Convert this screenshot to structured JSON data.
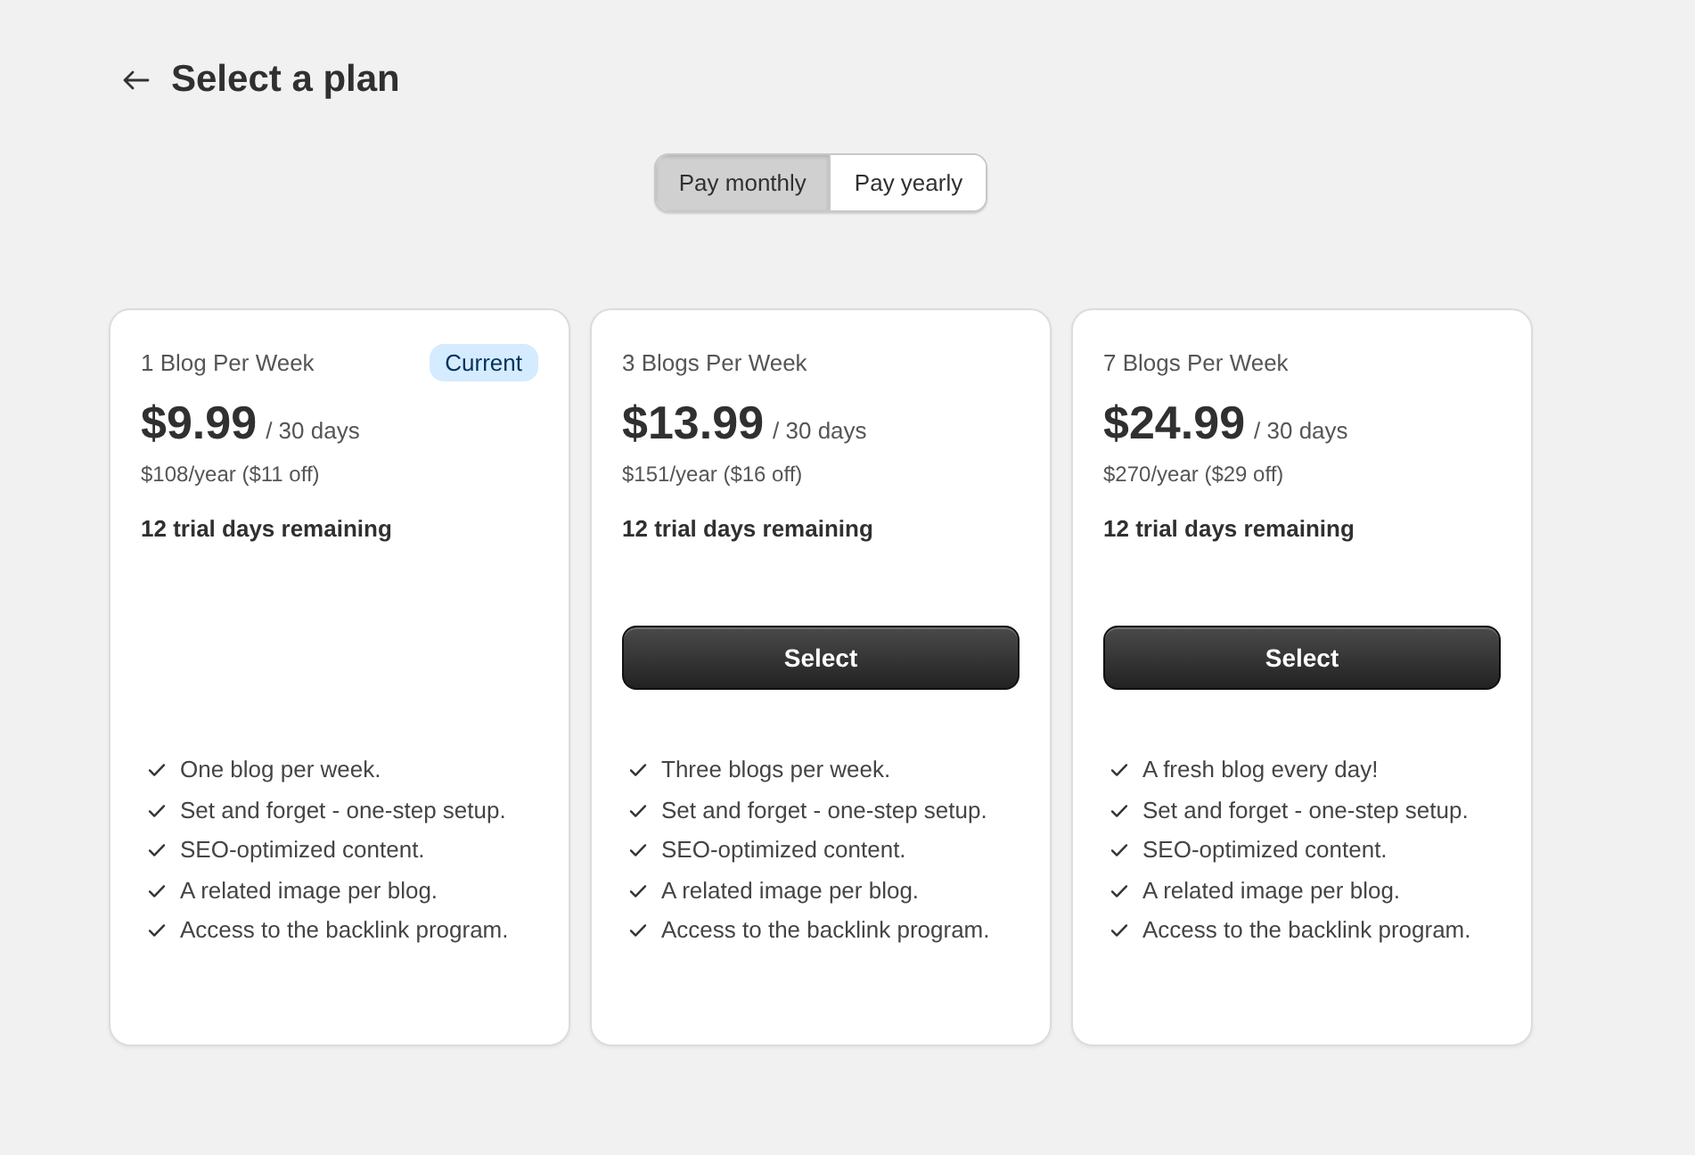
{
  "header": {
    "title": "Select a plan"
  },
  "billing_toggle": [
    {
      "label": "Pay monthly",
      "selected": true
    },
    {
      "label": "Pay yearly",
      "selected": false
    }
  ],
  "plans": [
    {
      "name": "1 Blog Per Week",
      "badge": "Current",
      "price": "$9.99",
      "period": "/ 30 days",
      "yearly": "$108/year ($11 off)",
      "trial": "12 trial days remaining",
      "features": [
        "One blog per week.",
        "Set and forget - one-step setup.",
        "SEO-optimized content.",
        "A related image per blog.",
        "Access to the backlink program."
      ]
    },
    {
      "name": "3 Blogs Per Week",
      "price": "$13.99",
      "period": "/ 30 days",
      "yearly": "$151/year ($16 off)",
      "trial": "12 trial days remaining",
      "button": "Select",
      "features": [
        "Three blogs per week.",
        "Set and forget - one-step setup.",
        "SEO-optimized content.",
        "A related image per blog.",
        "Access to the backlink program."
      ]
    },
    {
      "name": "7 Blogs Per Week",
      "price": "$24.99",
      "period": "/ 30 days",
      "yearly": "$270/year ($29 off)",
      "trial": "12 trial days remaining",
      "button": "Select",
      "features": [
        "A fresh blog every day!",
        "Set and forget - one-step setup.",
        "SEO-optimized content.",
        "A related image per blog.",
        "Access to the backlink program."
      ]
    }
  ]
}
